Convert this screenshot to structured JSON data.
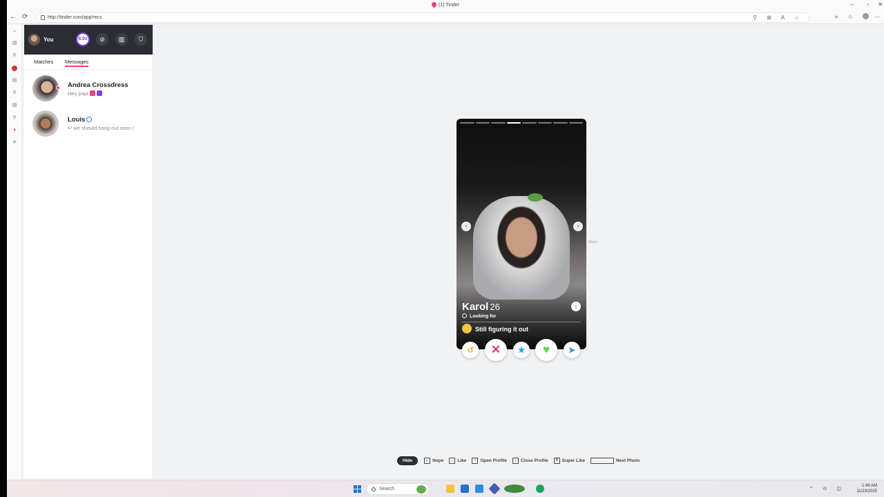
{
  "window": {
    "title": "(1) Tinder",
    "controls": [
      "–",
      "▫",
      "✕"
    ]
  },
  "browser": {
    "url": "http://tinder.com/app/recs",
    "nav": [
      "←",
      "⟳"
    ],
    "url_icons": "⚲ ⊞ A ☆",
    "right_icons": "⟡ ☆"
  },
  "profile_header": {
    "user_label": "You",
    "boost_label": "8.0x",
    "icons": [
      "compass-icon",
      "briefcase-icon",
      "shield-icon"
    ]
  },
  "tabs": [
    {
      "label": "Matches",
      "active": false
    },
    {
      "label": "Messages",
      "active": true
    }
  ],
  "messages": [
    {
      "name": "Andrea Crossdress",
      "preview": "Hey papi",
      "verified": false,
      "online": true
    },
    {
      "name": "Louis",
      "preview": "↩ we should hang out soon !",
      "verified": true,
      "online": false
    }
  ],
  "card": {
    "name": "Karol",
    "age": "26",
    "looking_for_label": "Looking for",
    "status": "Still figuring it out",
    "photo_count": 8,
    "active_photo": 4,
    "prev_arrow": "‹",
    "next_arrow": "›",
    "info_icon": "↑"
  },
  "actions": [
    {
      "name": "rewind-button",
      "glyph": "↺",
      "color": "#f5b748"
    },
    {
      "name": "nope-button",
      "glyph": "✕",
      "color": "#e6337b"
    },
    {
      "name": "super-like-button",
      "glyph": "★",
      "color": "#1ea5f6"
    },
    {
      "name": "like-button",
      "glyph": "♥",
      "color": "#5fd35a"
    },
    {
      "name": "boost-button",
      "glyph": "➤",
      "color": "#2f8ff0"
    }
  ],
  "cursor_label": "Ricky",
  "hints": {
    "hide_label": "Hide",
    "items": [
      {
        "key": "←",
        "label": "Nope"
      },
      {
        "key": "→",
        "label": "Like"
      },
      {
        "key": "↑",
        "label": "Open Profile"
      },
      {
        "key": "↓",
        "label": "Close Profile"
      },
      {
        "key": "⇧",
        "label": "Super Like"
      },
      {
        "key": "",
        "label": "Next Photo"
      }
    ]
  },
  "taskbar": {
    "search_placeholder": "Search",
    "time": "1:49 AM",
    "date": "11/23/2025",
    "tray": "⌃ ⊙ ◫"
  }
}
